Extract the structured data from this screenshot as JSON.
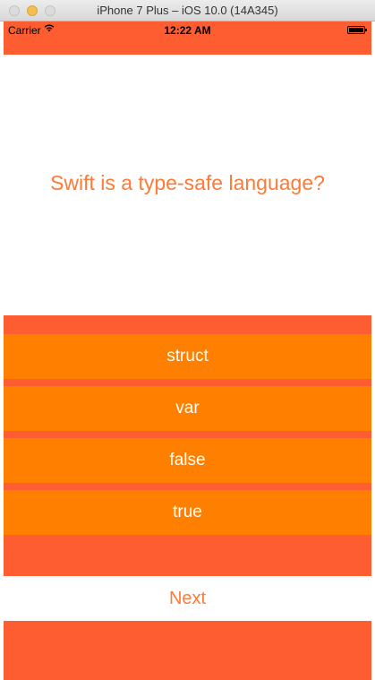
{
  "window": {
    "title": "iPhone 7 Plus – iOS 10.0 (14A345)"
  },
  "status_bar": {
    "carrier": "Carrier",
    "wifi_icon": "wifi-icon",
    "time": "12:22 AM",
    "battery_icon": "battery-icon"
  },
  "quiz": {
    "question": "Swift is a type-safe language?",
    "answers": [
      {
        "label": "struct"
      },
      {
        "label": "var"
      },
      {
        "label": "false"
      },
      {
        "label": "true"
      }
    ],
    "next_label": "Next"
  },
  "colors": {
    "background": "#fe5c31",
    "answer_button": "#ff8000",
    "question_text": "#fe7a36",
    "answer_text": "#ffffff"
  }
}
